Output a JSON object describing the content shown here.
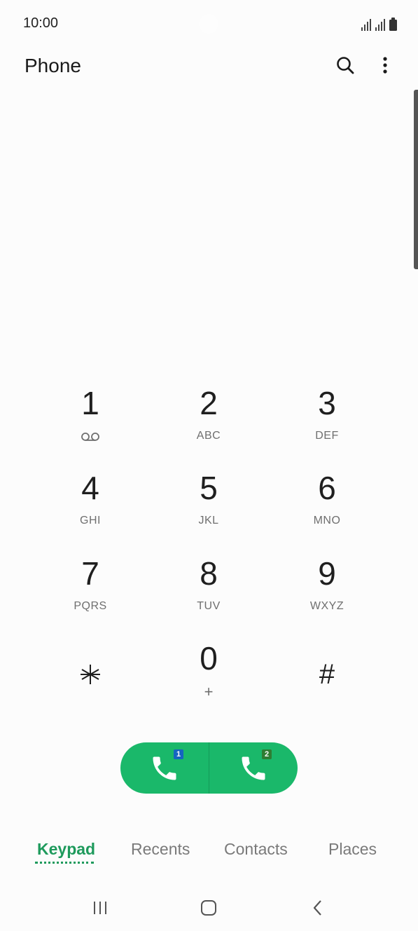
{
  "status_bar": {
    "time": "10:00",
    "icons": [
      "sim1-signal-icon",
      "sim2-signal-icon",
      "battery-icon"
    ]
  },
  "app_bar": {
    "title": "Phone",
    "icons": [
      "search-icon",
      "more-options-icon"
    ]
  },
  "keypad": {
    "keys": [
      {
        "digit": "1",
        "letters": "",
        "icon": "voicemail-icon"
      },
      {
        "digit": "2",
        "letters": "ABC"
      },
      {
        "digit": "3",
        "letters": "DEF"
      },
      {
        "digit": "4",
        "letters": "GHI"
      },
      {
        "digit": "5",
        "letters": "JKL"
      },
      {
        "digit": "6",
        "letters": "MNO"
      },
      {
        "digit": "7",
        "letters": "PQRS"
      },
      {
        "digit": "8",
        "letters": "TUV"
      },
      {
        "digit": "9",
        "letters": "WXYZ"
      },
      {
        "digit": "*",
        "letters": ""
      },
      {
        "digit": "0",
        "letters": "+"
      },
      {
        "digit": "#",
        "letters": ""
      }
    ]
  },
  "call_buttons": [
    {
      "sim": "1",
      "sim_color": "#1565c0",
      "icon": "phone-icon"
    },
    {
      "sim": "2",
      "sim_color": "#2e7d32",
      "icon": "phone-icon"
    }
  ],
  "colors": {
    "accent": "#1e9a5c",
    "call_button": "#1ab86a"
  },
  "tabs": [
    {
      "label": "Keypad",
      "active": true
    },
    {
      "label": "Recents",
      "active": false
    },
    {
      "label": "Contacts",
      "active": false
    },
    {
      "label": "Places",
      "active": false
    }
  ],
  "nav_bar": {
    "icons": [
      "recent-apps-icon",
      "home-icon",
      "back-icon"
    ]
  }
}
